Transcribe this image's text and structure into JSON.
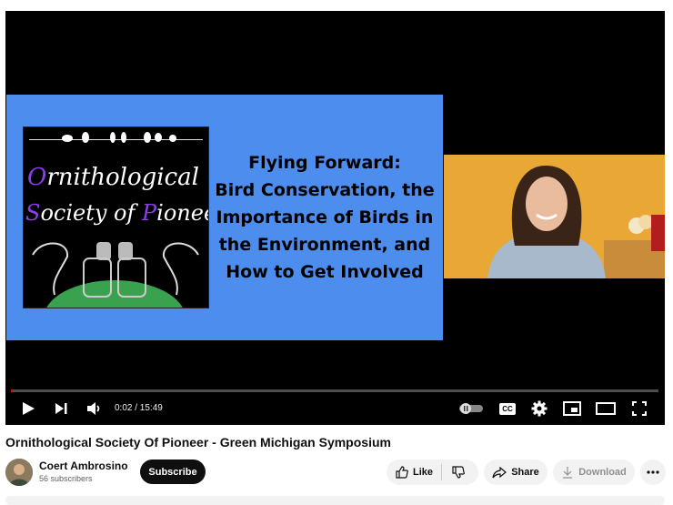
{
  "video": {
    "slide": {
      "logo_line1": "rnithological",
      "logo_line1_initial": "O",
      "logo_line2a": "ociety of ",
      "logo_line2_initial": "S",
      "logo_line2_p": "P",
      "logo_line2b": "ioneer",
      "title_lines": [
        "Flying Forward:",
        "Bird Conservation, the",
        "Importance of Birds in",
        "the Environment, and",
        "How to Get Involved"
      ]
    },
    "progress_fraction": 0.0021,
    "time_display": "0:02 / 15:49"
  },
  "icons": {
    "play": "play-icon",
    "next": "next-icon",
    "volume": "volume-icon",
    "autoplay": "autoplay-toggle-icon",
    "captions": "captions-icon",
    "settings": "gear-icon",
    "miniplayer": "miniplayer-icon",
    "theater": "theater-icon",
    "fullscreen": "fullscreen-icon",
    "like": "thumbs-up-icon",
    "dislike": "thumbs-down-icon",
    "share": "share-icon",
    "download": "download-icon",
    "more": "more-icon"
  },
  "captions_label": "CC",
  "info": {
    "title": "Ornithological Society Of Pioneer - Green Michigan Symposium",
    "channel_name": "Coert Ambrosino",
    "subscribers": "56 subscribers",
    "subscribe_label": "Subscribe",
    "like_label": "Like",
    "share_label": "Share",
    "download_label": "Download"
  },
  "colors": {
    "accent": "#ff0000",
    "slide_bg": "#4c8ded",
    "webcam_bg": "#e9a735",
    "logo_accent": "#8d3df0"
  }
}
